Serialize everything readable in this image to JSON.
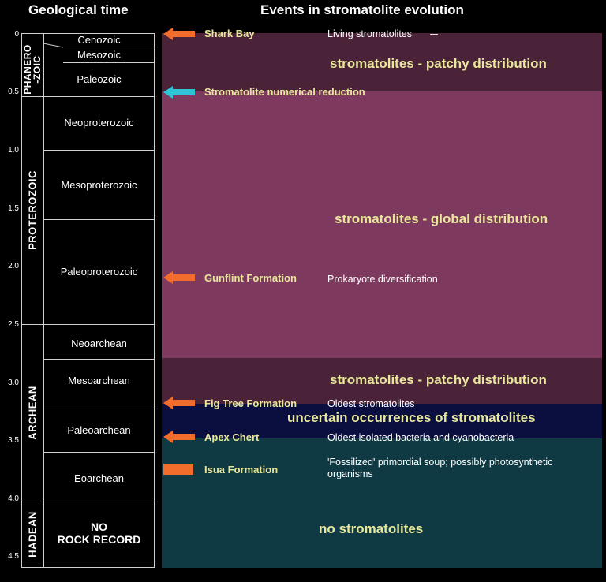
{
  "headers": {
    "left": "Geological time",
    "right": "Events in stromatolite evolution"
  },
  "ticks": [
    "0",
    "0.5",
    "1.0",
    "1.5",
    "2.0",
    "2.5",
    "3.0",
    "3.5",
    "4.0",
    "4.5"
  ],
  "eons": {
    "phanerozoic_line1": "PHANERO",
    "phanerozoic_line2": "-ZOIC",
    "proterozoic": "PROTEROZOIC",
    "archean": "ARCHEAN",
    "hadean": "HADEAN"
  },
  "eras": {
    "cenozoic": "Cenozoic",
    "mesozoic": "Mesozoic",
    "paleozoic": "Paleozoic",
    "neoproterozoic": "Neoproterozoic",
    "mesoproterozoic": "Mesoproterozoic",
    "paleoproterozoic": "Paleoproterozoic",
    "neoarchean": "Neoarchean",
    "mesoarchean": "Mesoarchean",
    "paleoarchean": "Paleoarchean",
    "eoarchean": "Eoarchean",
    "no_rock_line1": "NO",
    "no_rock_line2": "ROCK RECORD"
  },
  "bands": {
    "patchy_top": "stromatolites - patchy distribution",
    "global": "stromatolites - global distribution",
    "patchy_mid": "stromatolites - patchy distribution",
    "uncertain": "uncertain occurrences of stromatolites",
    "none": "no stromatolites"
  },
  "events": {
    "shark_bay": {
      "name": "Shark Bay",
      "desc": "Living stromatolites"
    },
    "reduction": {
      "name": "Stromatolite numerical reduction"
    },
    "gunflint": {
      "name": "Gunflint Formation",
      "desc": "Prokaryote diversification"
    },
    "fig_tree": {
      "name": "Fig Tree Formation",
      "desc": "Oldest stromatolites"
    },
    "apex": {
      "name": "Apex Chert",
      "desc": "Oldest isolated bacteria and cyanobacteria"
    },
    "isua": {
      "name": "Isua Formation",
      "desc": "'Fossilized' primordial soup; possibly photosynthetic organisms"
    }
  },
  "colors": {
    "patchy": "#4a2338",
    "global": "#7e3a5e",
    "uncertain": "#0a0f3f",
    "none": "#0f3a44",
    "arrow_orange": "#f26d2b",
    "arrow_cyan": "#2fc4d6",
    "label_yellow": "#e9e79c"
  }
}
